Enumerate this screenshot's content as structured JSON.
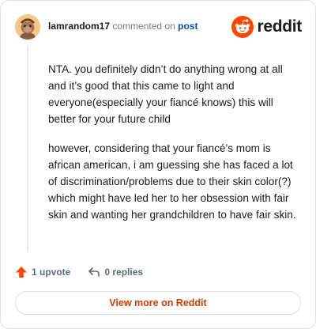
{
  "header": {
    "username": "lamrandom17",
    "action_text": "commented on",
    "post_link": "post",
    "brand_name": "reddit",
    "brand_color": "#ff4500"
  },
  "comment": {
    "paragraphs": [
      "NTA. you definitely didn’t do anything wrong at all and it’s good that this came to light and everyone(especially your fiancé knows) this will better for your future child",
      "however, considering that your fiancé’s mom is african american, i am guessing she has faced a lot of discrimination/problems due to their skin color(?) which might have led her to her obsession with fair skin and wanting her grandchildren to have fair skin."
    ]
  },
  "actions": {
    "upvote_label": "1 upvote",
    "replies_label": "0 replies"
  },
  "footer": {
    "view_more_label": "View more on Reddit",
    "accent_color": "#d93a00"
  },
  "icons": [
    "avatar-icon",
    "reddit-logo-icon",
    "upvote-arrow-icon",
    "reply-arrow-icon"
  ]
}
